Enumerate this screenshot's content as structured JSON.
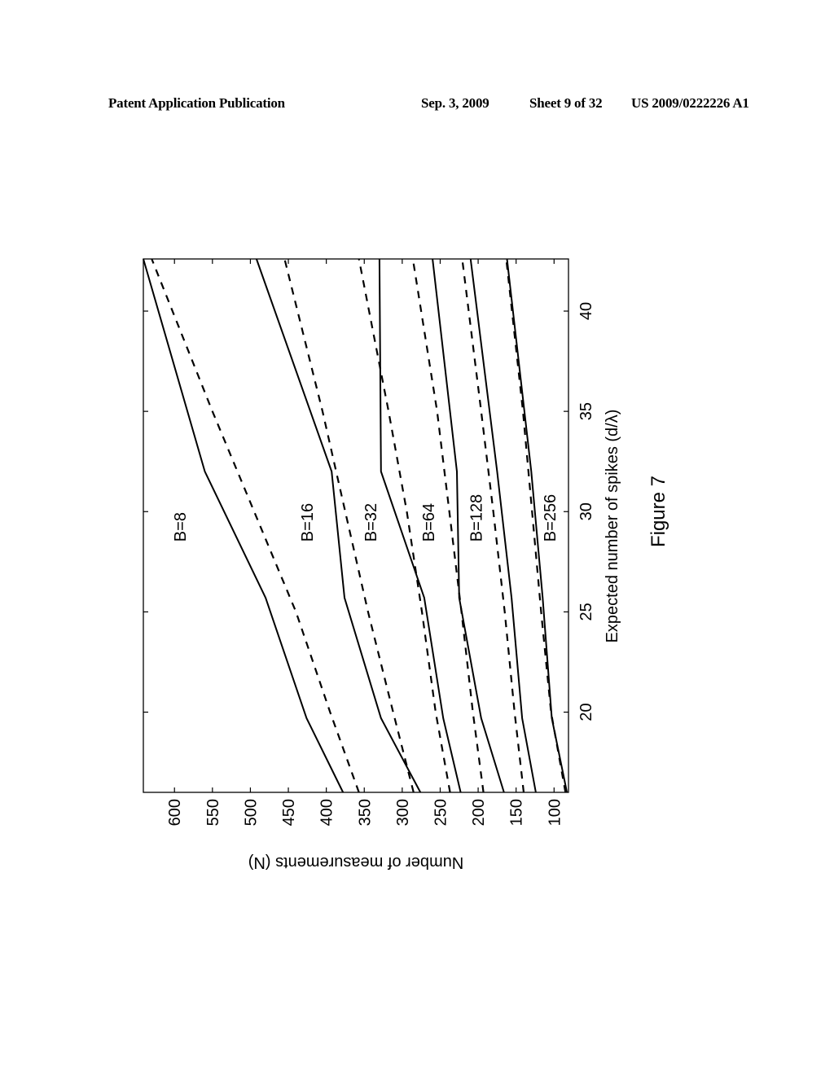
{
  "header": {
    "publication": "Patent Application Publication",
    "date": "Sep. 3, 2009",
    "sheet": "Sheet 9 of 32",
    "number": "US 2009/0222226 A1"
  },
  "figure": {
    "caption": "Figure 7",
    "orientation": "rotated 90° counter-clockwise on page"
  },
  "chart_data": {
    "type": "line",
    "title": "",
    "xlabel": "Expected number of spikes (d/λ)",
    "ylabel": "Number of measurements (N)",
    "xlim": [
      16.0,
      42.6
    ],
    "ylim": [
      81,
      641
    ],
    "xticks": [
      20,
      25,
      30,
      35,
      40
    ],
    "yticks": [
      100,
      150,
      200,
      250,
      300,
      350,
      400,
      450,
      500,
      550,
      600
    ],
    "grid": false,
    "legend": "none (inline curve labels)",
    "annotations": [
      {
        "text": "B=8",
        "x": 28.5,
        "y": 585
      },
      {
        "text": "B=16",
        "x": 28.5,
        "y": 418
      },
      {
        "text": "B=32",
        "x": 28.5,
        "y": 334
      },
      {
        "text": "B=64",
        "x": 28.5,
        "y": 258
      },
      {
        "text": "B=128",
        "x": 28.5,
        "y": 195
      },
      {
        "text": "B=256",
        "x": 28.5,
        "y": 98
      }
    ],
    "series": [
      {
        "name": "B=8 (solid)",
        "style": "solid",
        "x": [
          16.0,
          19.7,
          25.7,
          32.0,
          42.6
        ],
        "y": [
          378,
          426,
          480,
          560,
          641
        ]
      },
      {
        "name": "B=8 (dashed)",
        "style": "dashed",
        "x": [
          16.0,
          20.0,
          25.0,
          30.0,
          35.0,
          42.6
        ],
        "y": [
          357,
          395,
          440,
          495,
          550,
          630
        ]
      },
      {
        "name": "B=16 (solid)",
        "style": "solid",
        "x": [
          16.0,
          19.7,
          25.7,
          32.0,
          42.6
        ],
        "y": [
          276,
          328,
          376,
          393,
          492
        ]
      },
      {
        "name": "B=16 (dashed)",
        "style": "dashed",
        "x": [
          16.0,
          20.0,
          25.0,
          30.0,
          35.0,
          42.6
        ],
        "y": [
          285,
          312,
          345,
          375,
          405,
          455
        ]
      },
      {
        "name": "B=32 (solid)",
        "style": "solid",
        "x": [
          16.0,
          19.7,
          25.7,
          32.0,
          42.6
        ],
        "y": [
          223,
          246,
          271,
          328,
          330
        ]
      },
      {
        "name": "B=32 (dashed)",
        "style": "dashed",
        "x": [
          16.0,
          20.0,
          25.0,
          30.0,
          35.0,
          42.6
        ],
        "y": [
          237,
          256,
          274,
          294,
          318,
          357
        ]
      },
      {
        "name": "B=64 (solid)",
        "style": "solid",
        "x": [
          16.0,
          19.7,
          25.7,
          32.0,
          42.6
        ],
        "y": [
          166,
          196,
          225,
          228,
          260
        ]
      },
      {
        "name": "B=64 (dashed)",
        "style": "dashed",
        "x": [
          16.0,
          20.0,
          25.0,
          30.0,
          35.0,
          42.6
        ],
        "y": [
          193,
          207,
          222,
          238,
          254,
          286
        ]
      },
      {
        "name": "B=128 (solid)",
        "style": "solid",
        "x": [
          16.0,
          19.7,
          25.7,
          32.0,
          42.6
        ],
        "y": [
          124,
          142,
          156,
          175,
          210
        ]
      },
      {
        "name": "B=128 (dashed)",
        "style": "dashed",
        "x": [
          16.0,
          20.0,
          25.0,
          30.0,
          35.0,
          42.6
        ],
        "y": [
          140,
          152,
          165,
          180,
          196,
          221
        ]
      },
      {
        "name": "B=256 (solid)",
        "style": "solid",
        "x": [
          16.0,
          19.7,
          25.7,
          32.0,
          42.6
        ],
        "y": [
          83,
          103,
          115,
          130,
          162
        ]
      },
      {
        "name": "B=256 (dashed)",
        "style": "dashed",
        "x": [
          16.0,
          20.0,
          25.0,
          30.0,
          35.0,
          42.6
        ],
        "y": [
          85,
          104,
          117,
          129,
          141,
          163
        ]
      }
    ]
  }
}
